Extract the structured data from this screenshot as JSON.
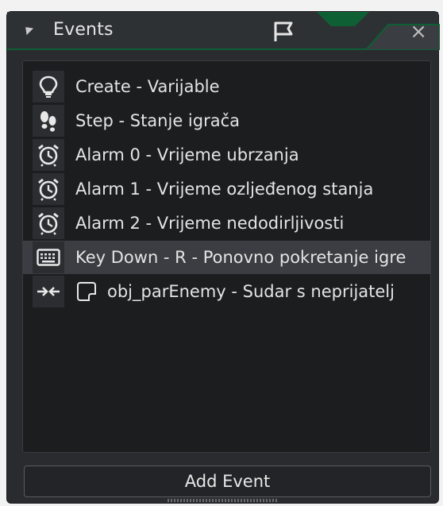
{
  "window": {
    "title": "Events",
    "close_glyph": "×",
    "accent_color": "#0f5f35",
    "icons": [
      "collapse-arrow-icon",
      "flag-icon",
      "close-icon"
    ]
  },
  "events": [
    {
      "icon": "lightbulb-icon",
      "label": "Create - Varijable"
    },
    {
      "icon": "footsteps-icon",
      "label": "Step - Stanje igrača"
    },
    {
      "icon": "alarm-clock-icon",
      "label": "Alarm 0 - Vrijeme ubrzanja"
    },
    {
      "icon": "alarm-clock-icon",
      "label": "Alarm 1 - Vrijeme ozljeđenog stanja"
    },
    {
      "icon": "alarm-clock-icon",
      "label": "Alarm 2 - Vrijeme nedodirljivosti"
    },
    {
      "icon": "keyboard-icon",
      "label": "Key Down - R - Ponovno pokretanje igre",
      "selected": true
    },
    {
      "icon": "collision-arrows-icon",
      "object_icon": "object-sprite-icon",
      "label": "obj_parEnemy - Sudar s neprijatelj"
    }
  ],
  "footer": {
    "add_event_label": "Add Event"
  }
}
